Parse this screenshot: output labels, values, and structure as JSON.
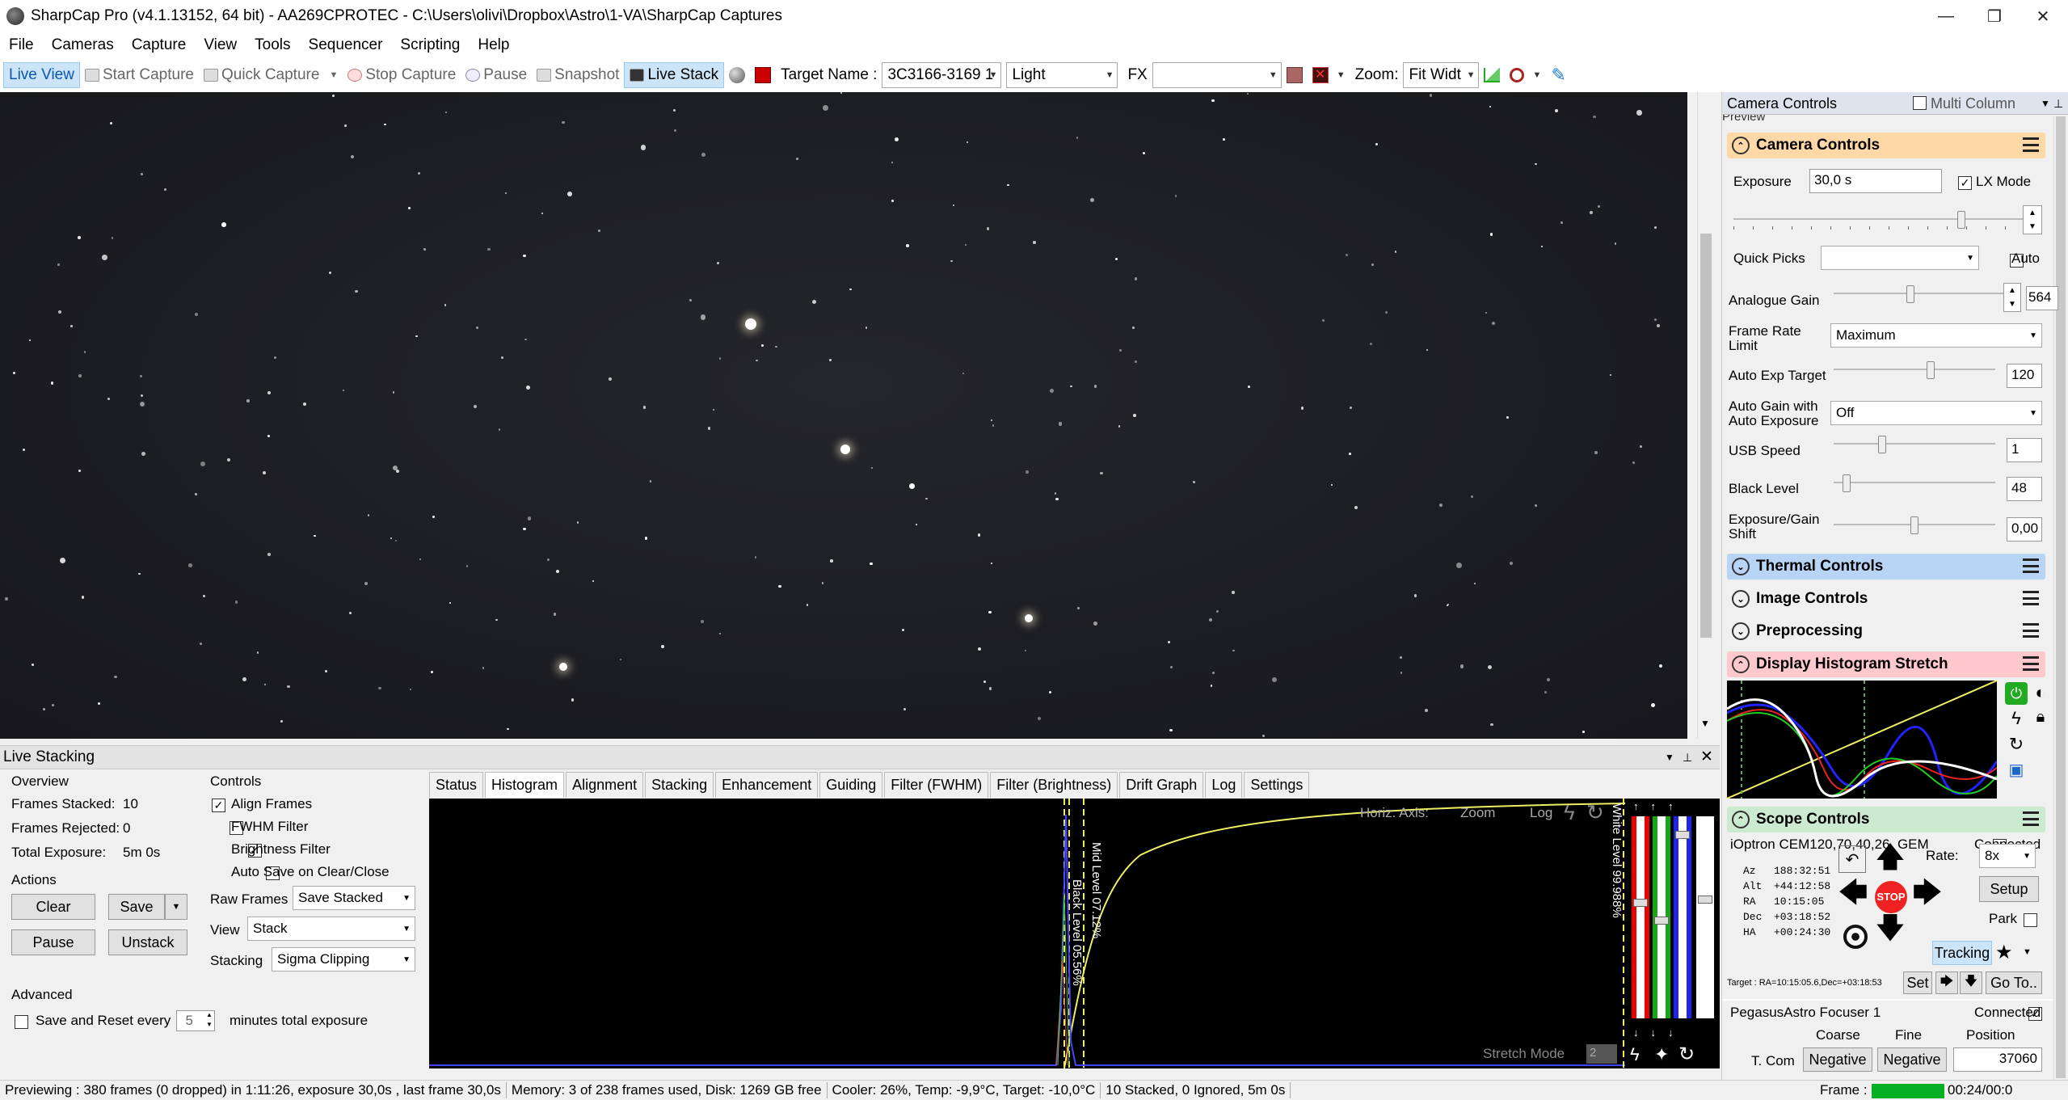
{
  "window": {
    "title": "SharpCap Pro (v4.1.13152, 64 bit) - AA269CPROTEC - C:\\Users\\olivi\\Dropbox\\Astro\\1-VA\\SharpCap Captures",
    "minimize": "—",
    "maximize": "❐",
    "close": "✕"
  },
  "menu": [
    "File",
    "Cameras",
    "Capture",
    "View",
    "Tools",
    "Sequencer",
    "Scripting",
    "Help"
  ],
  "toolbar": {
    "live_view": "Live View",
    "start_capture": "Start Capture",
    "quick_capture": "Quick Capture",
    "stop_capture": "Stop Capture",
    "pause": "Pause",
    "snapshot": "Snapshot",
    "live_stack": "Live Stack",
    "target_name_label": "Target Name :",
    "target_name_value": "3C3166-3169 1",
    "frame_type": "Light",
    "fx_label": "FX",
    "fx_value": "",
    "zoom_label": "Zoom:",
    "zoom_value": "Fit Widt"
  },
  "camera_panel": {
    "title": "Camera Controls",
    "multi_column": "Multi Column",
    "preview": "Preview",
    "section_camera": "Camera Controls",
    "exposure_label": "Exposure",
    "exposure_value": "30,0 s",
    "lx_mode": "LX Mode",
    "lx_checked": true,
    "exposure_slider": 0.75,
    "quick_picks_label": "Quick Picks",
    "quick_picks_value": "",
    "auto_label": "Auto",
    "analogue_gain_label": "Analogue Gain",
    "analogue_gain_value": "564",
    "analogue_gain_slider": 0.45,
    "frame_rate_label": "Frame Rate Limit",
    "frame_rate_value": "Maximum",
    "auto_exp_label": "Auto Exp Target",
    "auto_exp_value": "120",
    "auto_exp_slider": 0.6,
    "auto_gain_label": "Auto Gain with Auto Exposure",
    "auto_gain_value": "Off",
    "usb_label": "USB Speed",
    "usb_value": "1",
    "usb_slider": 0.3,
    "black_label": "Black Level",
    "black_value": "48",
    "black_slider": 0.08,
    "egshift_label": "Exposure/Gain Shift",
    "egshift_value": "0,00",
    "egshift_slider": 0.5,
    "section_thermal": "Thermal Controls",
    "section_image": "Image Controls",
    "section_preproc": "Preprocessing",
    "section_hist": "Display Histogram Stretch",
    "section_scope": "Scope Controls",
    "scope_name": "iOptron CEM120,70,40,26, GEM",
    "connected": "Connected",
    "rate_label": "Rate:",
    "rate_value": "8x",
    "setup": "Setup",
    "park": "Park",
    "stop": "STOP",
    "tracking": "Tracking",
    "az_label": "Az",
    "az": "188:32:51",
    "alt_label": "Alt",
    "alt": "+44:12:58",
    "ra_label": "RA",
    "ra": "10:15:05",
    "dec_label": "Dec",
    "dec": "+03:18:52",
    "ha_label": "HA",
    "ha": "+00:24:30",
    "target_line": "Target : RA=10:15:05.6,Dec=+03:18:53",
    "set": "Set",
    "goto": "Go To..",
    "focuser_name": "PegasusAstro Focuser 1",
    "focuser_connected": "Connected",
    "coarse": "Coarse",
    "fine": "Fine",
    "position_label": "Position",
    "tcomp": "T. Com",
    "negative1": "Negative",
    "negative2": "Negative",
    "position_value": "37060"
  },
  "live_stacking": {
    "title": "Live Stacking",
    "overview": "Overview",
    "frames_stacked_label": "Frames Stacked:",
    "frames_stacked": "10",
    "frames_rejected_label": "Frames Rejected:",
    "frames_rejected": "0",
    "total_exposure_label": "Total Exposure:",
    "total_exposure": "5m 0s",
    "actions": "Actions",
    "clear": "Clear",
    "save": "Save",
    "pause": "Pause",
    "unstack": "Unstack",
    "advanced": "Advanced",
    "save_reset": "Save and Reset every",
    "save_reset_value": "5",
    "minutes": "minutes total exposure",
    "controls": "Controls",
    "align": "Align Frames",
    "fwhm": "FWHM Filter",
    "brightness": "Brightness Filter",
    "autosave": "Auto Save on Clear/Close",
    "raw_frames_label": "Raw Frames",
    "raw_frames_value": "Save Stacked",
    "view_label": "View",
    "view_value": "Stack",
    "stacking_label": "Stacking",
    "stacking_value": "Sigma Clipping",
    "tabs": [
      "Status",
      "Histogram",
      "Alignment",
      "Stacking",
      "Enhancement",
      "Guiding",
      "Filter (FWHM)",
      "Filter (Brightness)",
      "Drift Graph",
      "Log",
      "Settings"
    ],
    "horiz_axis": "Horiz. Axis:",
    "zoom": "Zoom",
    "log": "Log",
    "black_level": "Black Level 05.56%",
    "mid_level": "Mid Level  07.12%",
    "white_level": "White Level  99.988%",
    "stretch_mode": "Stretch Mode",
    "stretch_value": "2"
  },
  "status": {
    "previewing": "Previewing : 380 frames (0 dropped) in 1:11:26, exposure 30,0s , last frame 30,0s",
    "memory": "Memory: 3 of 238 frames used, Disk: 1269 GB free",
    "cooler": "Cooler: 26%, Temp: -9,9°C, Target: -10,0°C",
    "stacked": "10 Stacked, 0 Ignored, 5m 0s",
    "frame_label": "Frame :",
    "time": "00:24/00:0"
  }
}
